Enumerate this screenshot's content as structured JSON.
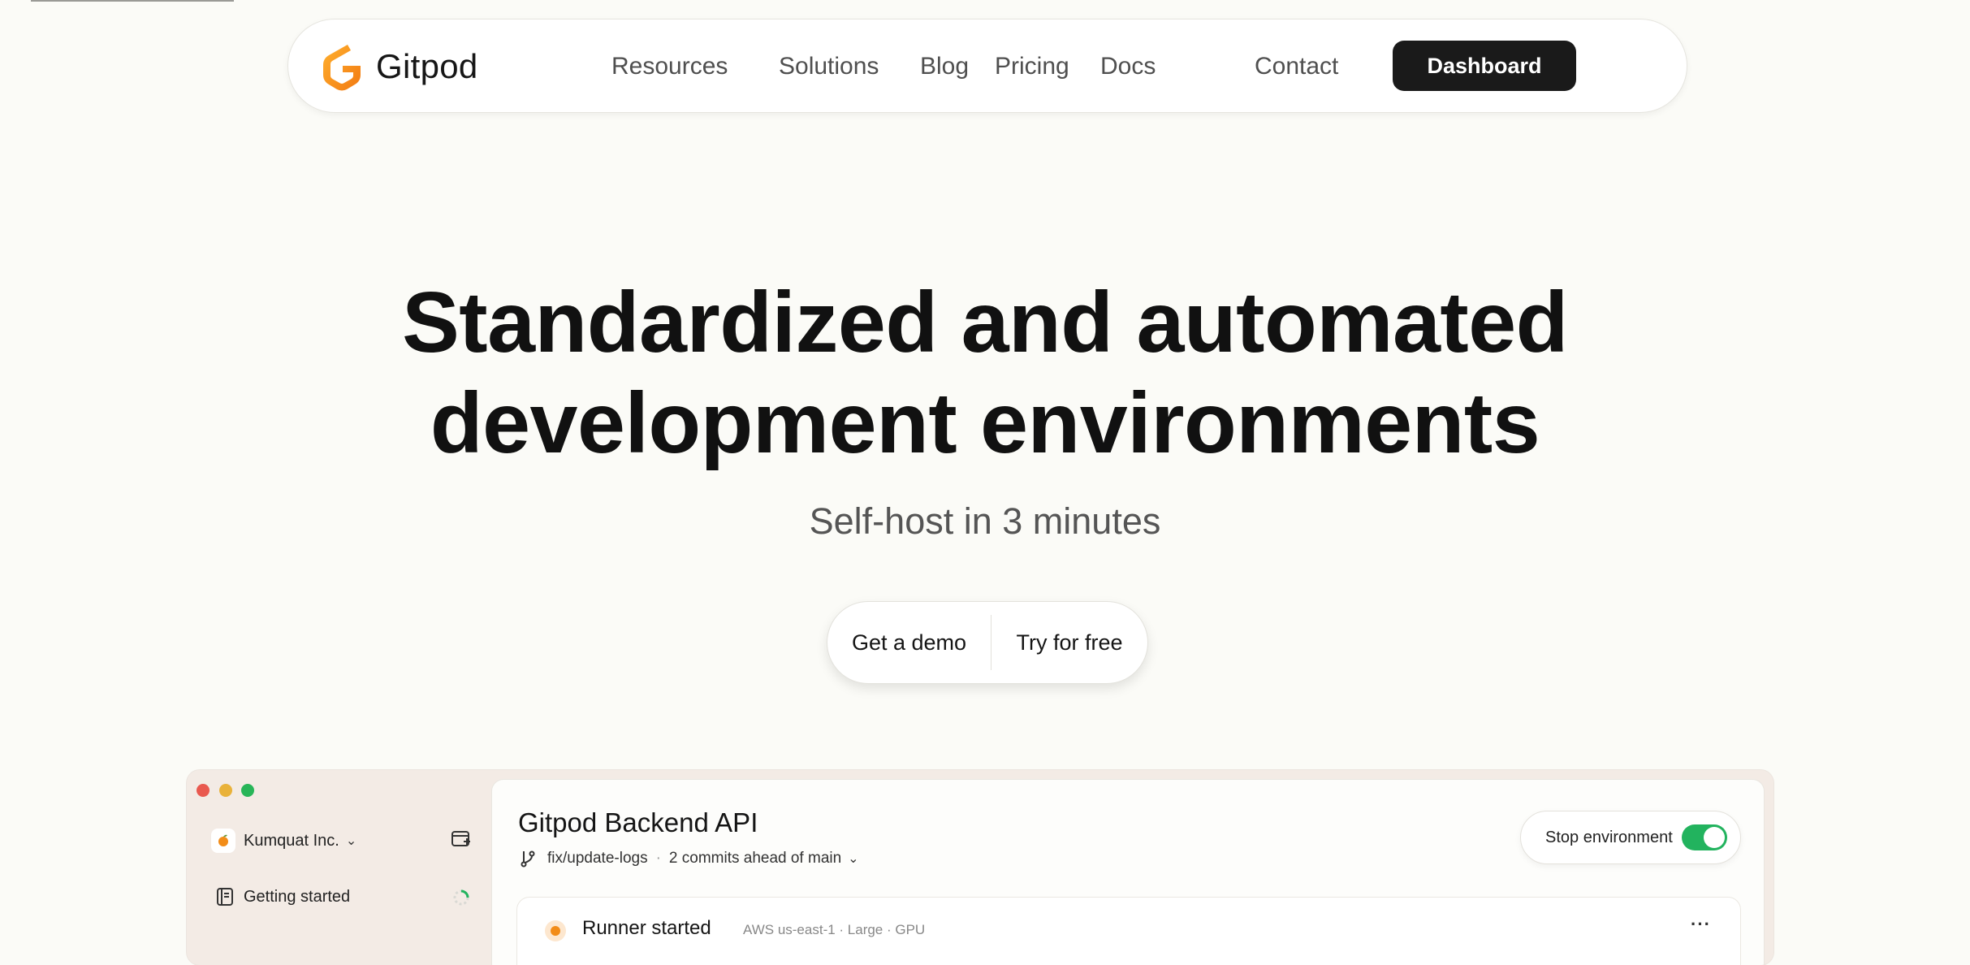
{
  "nav": {
    "brand": "Gitpod",
    "links": [
      "Resources",
      "Solutions",
      "Blog",
      "Pricing",
      "Docs"
    ],
    "contact": "Contact",
    "dashboard": "Dashboard"
  },
  "hero": {
    "title_line1": "Standardized and automated",
    "title_line2": "development environments",
    "subtitle": "Self-host in 3 minutes",
    "cta_demo": "Get a demo",
    "cta_try": "Try for free"
  },
  "app": {
    "org_name": "Kumquat Inc.",
    "sidebar_getting_started": "Getting started",
    "env_title": "Gitpod Backend API",
    "branch": "fix/update-logs",
    "commits": "2 commits ahead of main",
    "stop_env": "Stop environment",
    "runner_title": "Runner started",
    "runner_meta": "AWS us-east-1 · Large · GPU",
    "more": "···"
  },
  "colors": {
    "background": "#fbfbf7",
    "brand_orange": "#f7961c",
    "toggle_green": "#22b35e",
    "dashboard_bg": "#1a1a1a",
    "window_red": "#e9594f",
    "window_yellow": "#e9b23a",
    "window_green": "#28b558"
  }
}
